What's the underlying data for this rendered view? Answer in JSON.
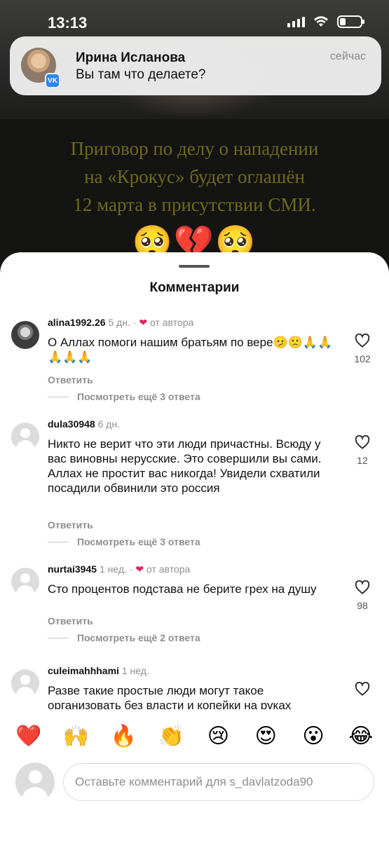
{
  "status_bar": {
    "time": "13:13"
  },
  "notification": {
    "name": "Ирина Исланова",
    "message": "Вы там что делаете?",
    "time": "сейчас",
    "badge": "VK"
  },
  "post": {
    "headline_line1": "Приговор по делу о нападении",
    "headline_line2": "на «Крокус» будет оглашён",
    "headline_line3": "12 марта в присутствии СМИ.",
    "emojis": "🥺💔🥺"
  },
  "sheet": {
    "title": "Комментарии"
  },
  "comments": [
    {
      "user": "alina1992.26",
      "age": "5 дн.",
      "author_liked": true,
      "author_label": "от автора",
      "text": "О Аллах помоги нашим братьям по вере🫤🙁🙏🙏🙏🙏🙏",
      "reply": "Ответить",
      "more": "Посмотреть ещё 3 ответа",
      "likes": "102"
    },
    {
      "user": "dula30948",
      "age": "6 дн.",
      "author_liked": false,
      "text": "Никто не верит что эти люди причастны. Всюду у вас виновны нерусские. Это совершили вы сами.  Аллах не простит вас никогда! Увидели схватили посадили обвинили это россия",
      "reply": "Ответить",
      "more": "Посмотреть ещё 3 ответа",
      "likes": "12"
    },
    {
      "user": "nurtai3945",
      "age": "1 нед.",
      "author_liked": true,
      "author_label": "от автора",
      "text": "Сто процентов подстава не берите грех на душу",
      "reply": "Ответить",
      "more": "Посмотреть ещё 2 ответа",
      "likes": "98"
    },
    {
      "user": "culeimahhhami",
      "age": "1 нед.",
      "author_liked": false,
      "text": "Разве такие простые люди могут такое организовать без власти и копейки на руках",
      "likes": ""
    }
  ],
  "reactions": [
    "❤️",
    "🙌",
    "🔥",
    "👏",
    "😢",
    "😍",
    "😮",
    "😂"
  ],
  "comment_input": {
    "placeholder": "Оставьте комментарий для s_davlatzoda90"
  }
}
